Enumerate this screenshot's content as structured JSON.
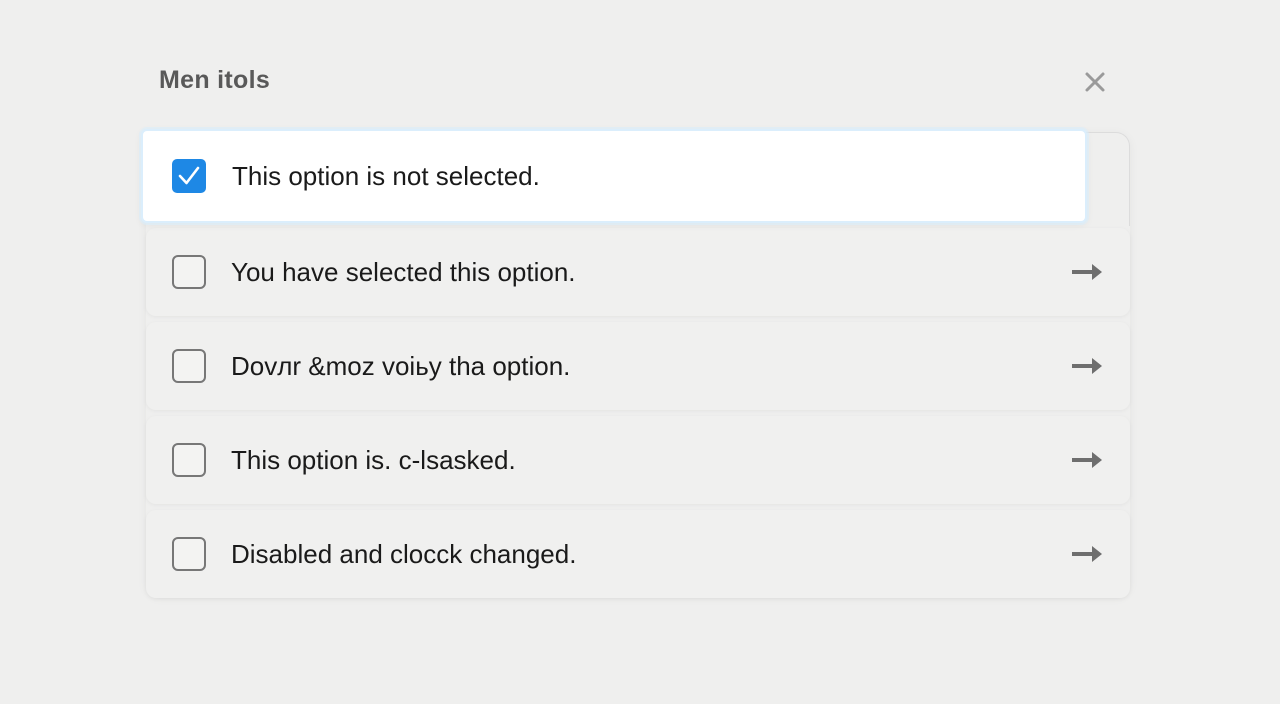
{
  "panel": {
    "title": "Men itols",
    "close_icon": "close-icon"
  },
  "options": [
    {
      "label": "This option is not selected.",
      "checked": true,
      "icon": "checkmark-icon"
    },
    {
      "label": "You have selected this option.",
      "checked": false,
      "icon": "arrow-right-icon"
    },
    {
      "label": "Dovлr &moz voiьy tha option.",
      "checked": false,
      "icon": "arrow-right-icon"
    },
    {
      "label": "This option is. c-lsasked.",
      "checked": false,
      "icon": "arrow-right-icon"
    },
    {
      "label": "Disabled and clocck changed.",
      "checked": false,
      "icon": "arrow-right-icon"
    }
  ],
  "colors": {
    "accent": "#1e88e5",
    "background": "#efefee",
    "title": "#595959",
    "arrow": "#6e6e6e"
  }
}
